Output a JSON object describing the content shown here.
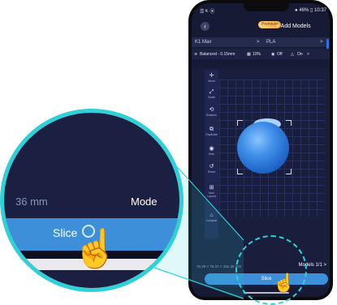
{
  "status_bar": {
    "left": "☰ ᴵᴵᴸ ⦿",
    "right": "● 46% ▯ 10:37"
  },
  "header": {
    "back_icon": "chevron-left-icon",
    "premium_label": "Premium",
    "add_models_label": "+ Add Models"
  },
  "printer_row": {
    "printer_name": "K1 Max",
    "separator": ">",
    "material": "PLA",
    "chevron": ">"
  },
  "settings_row": {
    "profile": "Balanced - 0.15mm",
    "infill": "10%",
    "support": "Off",
    "brim": "On",
    "chevron": ">"
  },
  "toolbar": {
    "items": [
      {
        "icon": "move-icon",
        "glyph": "✛",
        "label": "Move"
      },
      {
        "icon": "scale-icon",
        "glyph": "⤢",
        "label": "Scale"
      },
      {
        "icon": "rotate-icon",
        "glyph": "⟲",
        "label": "Rotation"
      },
      {
        "icon": "duplicate-icon",
        "glyph": "⧉",
        "label": "Duplicate"
      },
      {
        "icon": "hide-icon",
        "glyph": "◉",
        "label": "Hide"
      },
      {
        "icon": "reset-icon",
        "glyph": "↺",
        "label": "Reset"
      },
      {
        "icon": "auto-layout-icon",
        "glyph": "⊞",
        "label": "Auto Layout"
      },
      {
        "icon": "collapse-icon",
        "glyph": "⌂",
        "label": "Collapse"
      }
    ]
  },
  "bottom_info": {
    "dimensions": "75.29 × 76.37 × 151.35 mm",
    "models_label": "Models",
    "models_count": "1/1",
    "chevron": ">"
  },
  "slice_button": {
    "label": "Slice"
  },
  "zoom": {
    "dimensions_fragment": "36 mm",
    "models_fragment": "Mode",
    "slice_label": "Slice"
  },
  "colors": {
    "accent": "#3e8fd9",
    "highlight": "#2fd0d8",
    "background": "#161a35",
    "model": "#3f8fe8"
  }
}
